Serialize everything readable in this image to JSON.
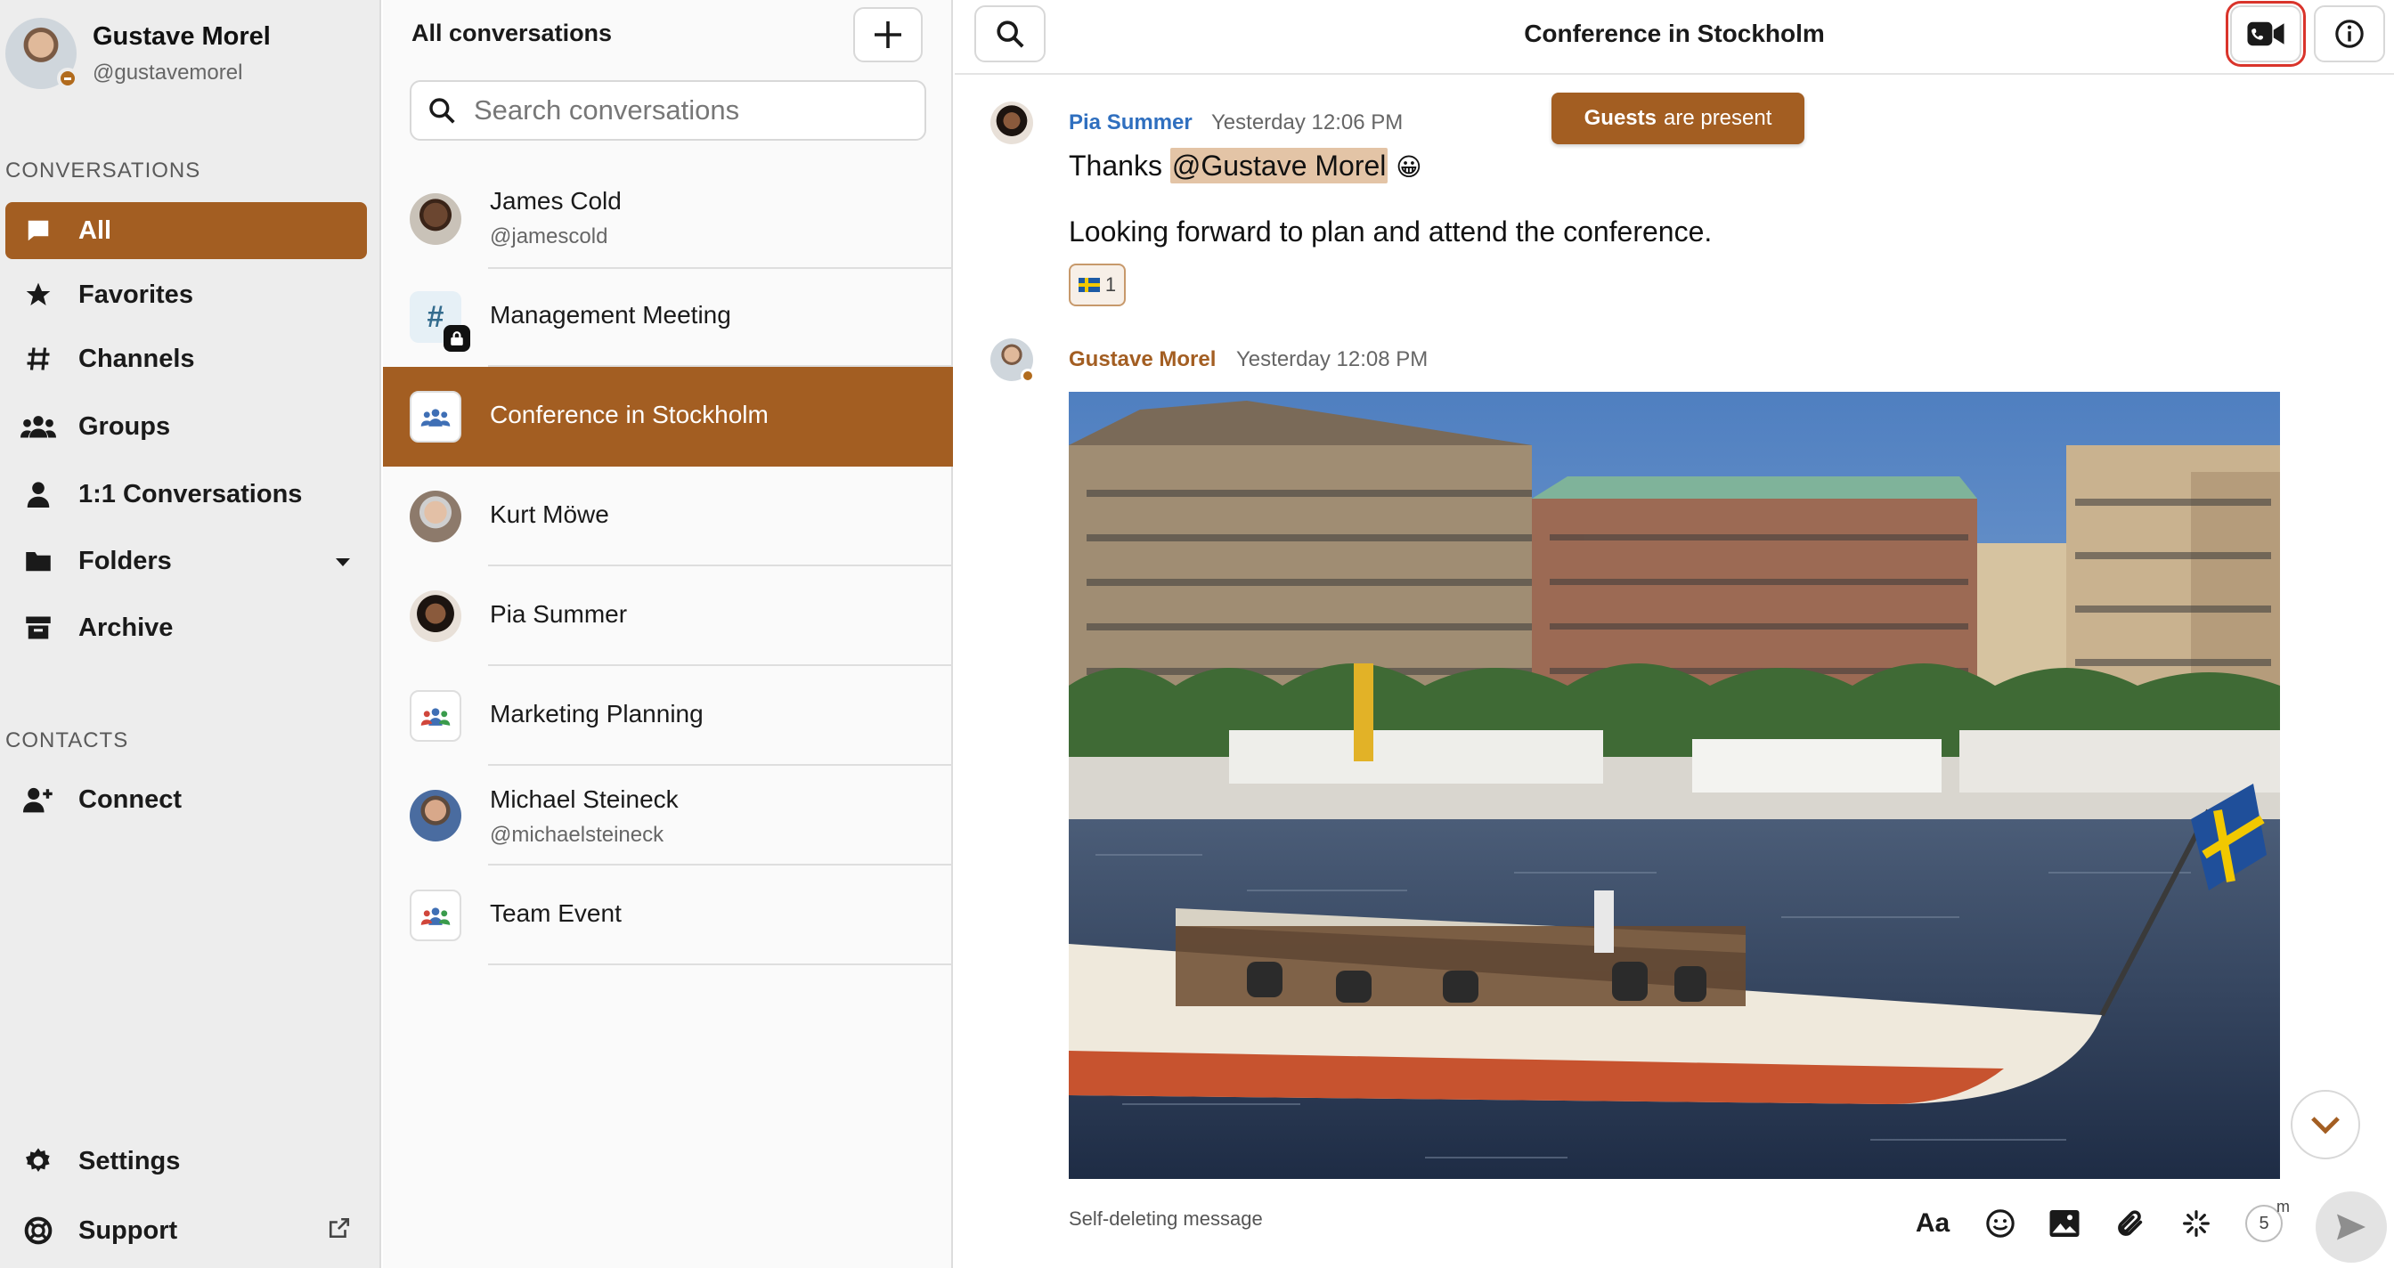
{
  "user": {
    "name": "Gustave Morel",
    "handle": "@gustavemorel"
  },
  "sidebar": {
    "conversations_title": "CONVERSATIONS",
    "items": [
      {
        "label": "All",
        "icon": "chat-bubble-icon",
        "active": true
      },
      {
        "label": "Favorites",
        "icon": "star-icon"
      },
      {
        "label": "Channels",
        "icon": "hash-icon"
      },
      {
        "label": "Groups",
        "icon": "group-icon"
      },
      {
        "label": "1:1 Conversations",
        "icon": "person-icon"
      },
      {
        "label": "Folders",
        "icon": "folder-icon"
      },
      {
        "label": "Archive",
        "icon": "archive-icon"
      }
    ],
    "contacts_title": "CONTACTS",
    "connect_label": "Connect",
    "settings_label": "Settings",
    "support_label": "Support"
  },
  "conversation_list": {
    "title": "All conversations",
    "search_placeholder": "Search conversations",
    "items": [
      {
        "name": "James Cold",
        "sub": "@jamescold",
        "type": "person"
      },
      {
        "name": "Management Meeting",
        "sub": "",
        "type": "channel-private"
      },
      {
        "name": "Conference in Stockholm",
        "sub": "",
        "type": "group",
        "active": true
      },
      {
        "name": "Kurt Möwe",
        "sub": "",
        "type": "person"
      },
      {
        "name": "Pia Summer",
        "sub": "",
        "type": "person"
      },
      {
        "name": "Marketing Planning",
        "sub": "",
        "type": "group"
      },
      {
        "name": "Michael Steineck",
        "sub": "@michaelsteineck",
        "type": "person"
      },
      {
        "name": "Team Event",
        "sub": "",
        "type": "group"
      }
    ]
  },
  "chat": {
    "title": "Conference in Stockholm",
    "guests_bold": "Guests",
    "guests_rest": "are present",
    "messages": [
      {
        "author": "Pia Summer",
        "author_color": "#2f6fbf",
        "time": "Yesterday 12:06 PM",
        "text_prefix": "Thanks ",
        "mention": "@Gustave Morel",
        "emoji": "😀",
        "text2": "Looking forward to plan and attend the conference.",
        "reaction_count": "1"
      },
      {
        "author": "Gustave Morel",
        "author_color": "#a35e22",
        "time": "Yesterday 12:08 PM",
        "attachment": "photo"
      }
    ],
    "composer_placeholder": "Self-deleting message",
    "timer_value": "5",
    "timer_unit": "m"
  },
  "colors": {
    "accent": "#a35e22",
    "sidebar_bg": "#ededed",
    "list_bg": "#fafafa",
    "highlight_red": "#d9342b"
  }
}
